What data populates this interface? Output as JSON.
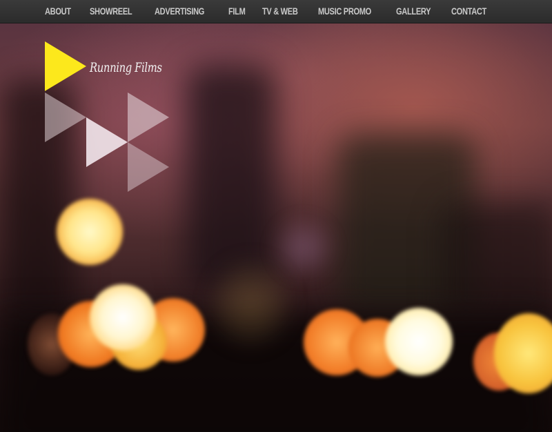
{
  "nav": {
    "items": [
      {
        "label": "ABOUT"
      },
      {
        "label": "SHOWREEL"
      },
      {
        "label": "ADVERTISING"
      },
      {
        "label": "FILM"
      },
      {
        "label": "TV & WEB"
      },
      {
        "label": "MUSIC PROMO"
      },
      {
        "label": "GALLERY"
      },
      {
        "label": "CONTACT"
      }
    ]
  },
  "brand": {
    "name": "Running Films",
    "accent_color": "#fce81c",
    "mark_color": "#f2e9ee"
  },
  "colors": {
    "nav_bg": "#333333",
    "nav_text": "#c9c9c9"
  }
}
